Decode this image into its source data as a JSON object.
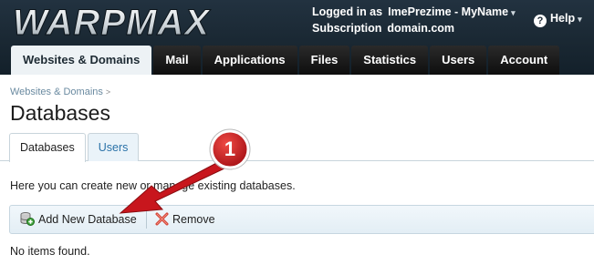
{
  "header": {
    "logo_text": "WARPMAX",
    "logged_in_label": "Logged in as",
    "user": "ImePrezime - MyName",
    "subscription_label": "Subscription",
    "subscription": "domain.com",
    "help": "Help"
  },
  "nav": {
    "tabs": [
      {
        "label": "Websites & Domains",
        "active": true
      },
      {
        "label": "Mail"
      },
      {
        "label": "Applications"
      },
      {
        "label": "Files"
      },
      {
        "label": "Statistics"
      },
      {
        "label": "Users"
      },
      {
        "label": "Account"
      }
    ]
  },
  "breadcrumb": {
    "item": "Websites & Domains",
    "sep": ">"
  },
  "page_title": "Databases",
  "subtabs": [
    {
      "label": "Databases",
      "active": true
    },
    {
      "label": "Users"
    }
  ],
  "description": "Here you can create new or manage existing databases.",
  "toolbar": {
    "add_label": "Add New Database",
    "remove_label": "Remove"
  },
  "empty_message": "No items found.",
  "callout": {
    "number": "1",
    "color": "#c8161d"
  },
  "colors": {
    "header_bg": "#1b2833",
    "link": "#2a72a8",
    "toolbar_bg": "#e8f1f7"
  }
}
